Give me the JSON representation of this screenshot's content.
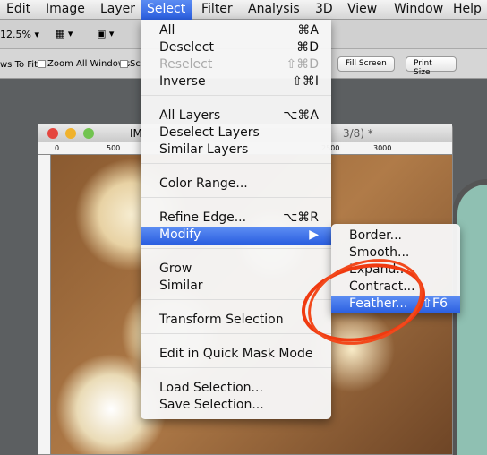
{
  "menubar": [
    "Edit",
    "Image",
    "Layer",
    "Select",
    "Filter",
    "Analysis",
    "3D",
    "View",
    "Window",
    "Help"
  ],
  "toolbar": {
    "zoom": "12.5%",
    "layout_icon": "arrange-documents-icon",
    "screen_mode_icon": "screen-mode-icon"
  },
  "options": {
    "fit_label": "ws To Fit",
    "zoom_all": "Zoom All Windows",
    "scrubby": "Sc",
    "fill_screen": "Fill Screen",
    "print_size": "Print Size"
  },
  "document": {
    "title_start": "IM",
    "title_end": "3/8) *",
    "ruler": [
      "0",
      "500",
      "2500",
      "3000"
    ]
  },
  "select_menu": [
    {
      "label": "All",
      "shortcut": "⌘A"
    },
    {
      "label": "Deselect",
      "shortcut": "⌘D"
    },
    {
      "label": "Reselect",
      "shortcut": "⇧⌘D",
      "disabled": true
    },
    {
      "label": "Inverse",
      "shortcut": "⇧⌘I"
    },
    {
      "label": "All Layers",
      "shortcut": "⌥⌘A"
    },
    {
      "label": "Deselect Layers",
      "shortcut": ""
    },
    {
      "label": "Similar Layers",
      "shortcut": ""
    },
    {
      "label": "Color Range...",
      "shortcut": ""
    },
    {
      "label": "Refine Edge...",
      "shortcut": "⌥⌘R"
    },
    {
      "label": "Modify",
      "shortcut": "▶",
      "highlighted": true
    },
    {
      "label": "Grow",
      "shortcut": ""
    },
    {
      "label": "Similar",
      "shortcut": ""
    },
    {
      "label": "Transform Selection",
      "shortcut": ""
    },
    {
      "label": "Edit in Quick Mask Mode",
      "shortcut": ""
    },
    {
      "label": "Load Selection...",
      "shortcut": ""
    },
    {
      "label": "Save Selection...",
      "shortcut": ""
    }
  ],
  "modify_submenu": [
    {
      "label": "Border...",
      "shortcut": ""
    },
    {
      "label": "Smooth...",
      "shortcut": ""
    },
    {
      "label": "Expand...",
      "shortcut": ""
    },
    {
      "label": "Contract...",
      "shortcut": ""
    },
    {
      "label": "Feather...",
      "shortcut": "⇧F6",
      "highlighted": true
    }
  ],
  "colors": {
    "highlight": "#3a6ee8",
    "annotation": "#f03a10"
  }
}
